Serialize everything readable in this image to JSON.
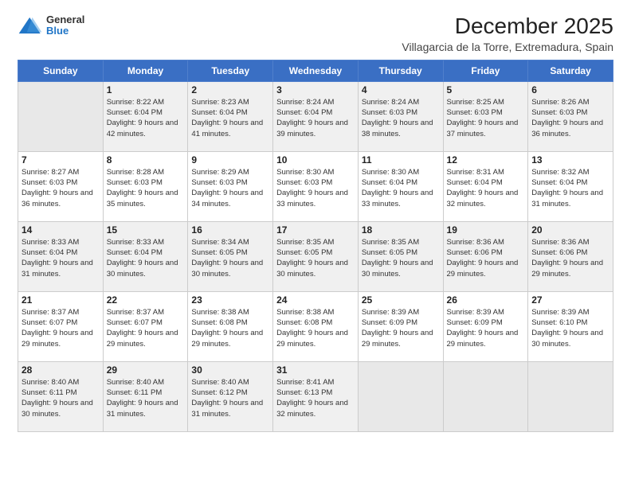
{
  "logo": {
    "general": "General",
    "blue": "Blue"
  },
  "header": {
    "title": "December 2025",
    "subtitle": "Villagarcia de la Torre, Extremadura, Spain"
  },
  "weekdays": [
    "Sunday",
    "Monday",
    "Tuesday",
    "Wednesday",
    "Thursday",
    "Friday",
    "Saturday"
  ],
  "weeks": [
    [
      {
        "day": "",
        "sunrise": "",
        "sunset": "",
        "daylight": "",
        "empty": true
      },
      {
        "day": "1",
        "sunrise": "Sunrise: 8:22 AM",
        "sunset": "Sunset: 6:04 PM",
        "daylight": "Daylight: 9 hours and 42 minutes."
      },
      {
        "day": "2",
        "sunrise": "Sunrise: 8:23 AM",
        "sunset": "Sunset: 6:04 PM",
        "daylight": "Daylight: 9 hours and 41 minutes."
      },
      {
        "day": "3",
        "sunrise": "Sunrise: 8:24 AM",
        "sunset": "Sunset: 6:04 PM",
        "daylight": "Daylight: 9 hours and 39 minutes."
      },
      {
        "day": "4",
        "sunrise": "Sunrise: 8:24 AM",
        "sunset": "Sunset: 6:03 PM",
        "daylight": "Daylight: 9 hours and 38 minutes."
      },
      {
        "day": "5",
        "sunrise": "Sunrise: 8:25 AM",
        "sunset": "Sunset: 6:03 PM",
        "daylight": "Daylight: 9 hours and 37 minutes."
      },
      {
        "day": "6",
        "sunrise": "Sunrise: 8:26 AM",
        "sunset": "Sunset: 6:03 PM",
        "daylight": "Daylight: 9 hours and 36 minutes."
      }
    ],
    [
      {
        "day": "7",
        "sunrise": "Sunrise: 8:27 AM",
        "sunset": "Sunset: 6:03 PM",
        "daylight": "Daylight: 9 hours and 36 minutes."
      },
      {
        "day": "8",
        "sunrise": "Sunrise: 8:28 AM",
        "sunset": "Sunset: 6:03 PM",
        "daylight": "Daylight: 9 hours and 35 minutes."
      },
      {
        "day": "9",
        "sunrise": "Sunrise: 8:29 AM",
        "sunset": "Sunset: 6:03 PM",
        "daylight": "Daylight: 9 hours and 34 minutes."
      },
      {
        "day": "10",
        "sunrise": "Sunrise: 8:30 AM",
        "sunset": "Sunset: 6:03 PM",
        "daylight": "Daylight: 9 hours and 33 minutes."
      },
      {
        "day": "11",
        "sunrise": "Sunrise: 8:30 AM",
        "sunset": "Sunset: 6:04 PM",
        "daylight": "Daylight: 9 hours and 33 minutes."
      },
      {
        "day": "12",
        "sunrise": "Sunrise: 8:31 AM",
        "sunset": "Sunset: 6:04 PM",
        "daylight": "Daylight: 9 hours and 32 minutes."
      },
      {
        "day": "13",
        "sunrise": "Sunrise: 8:32 AM",
        "sunset": "Sunset: 6:04 PM",
        "daylight": "Daylight: 9 hours and 31 minutes."
      }
    ],
    [
      {
        "day": "14",
        "sunrise": "Sunrise: 8:33 AM",
        "sunset": "Sunset: 6:04 PM",
        "daylight": "Daylight: 9 hours and 31 minutes."
      },
      {
        "day": "15",
        "sunrise": "Sunrise: 8:33 AM",
        "sunset": "Sunset: 6:04 PM",
        "daylight": "Daylight: 9 hours and 30 minutes."
      },
      {
        "day": "16",
        "sunrise": "Sunrise: 8:34 AM",
        "sunset": "Sunset: 6:05 PM",
        "daylight": "Daylight: 9 hours and 30 minutes."
      },
      {
        "day": "17",
        "sunrise": "Sunrise: 8:35 AM",
        "sunset": "Sunset: 6:05 PM",
        "daylight": "Daylight: 9 hours and 30 minutes."
      },
      {
        "day": "18",
        "sunrise": "Sunrise: 8:35 AM",
        "sunset": "Sunset: 6:05 PM",
        "daylight": "Daylight: 9 hours and 30 minutes."
      },
      {
        "day": "19",
        "sunrise": "Sunrise: 8:36 AM",
        "sunset": "Sunset: 6:06 PM",
        "daylight": "Daylight: 9 hours and 29 minutes."
      },
      {
        "day": "20",
        "sunrise": "Sunrise: 8:36 AM",
        "sunset": "Sunset: 6:06 PM",
        "daylight": "Daylight: 9 hours and 29 minutes."
      }
    ],
    [
      {
        "day": "21",
        "sunrise": "Sunrise: 8:37 AM",
        "sunset": "Sunset: 6:07 PM",
        "daylight": "Daylight: 9 hours and 29 minutes."
      },
      {
        "day": "22",
        "sunrise": "Sunrise: 8:37 AM",
        "sunset": "Sunset: 6:07 PM",
        "daylight": "Daylight: 9 hours and 29 minutes."
      },
      {
        "day": "23",
        "sunrise": "Sunrise: 8:38 AM",
        "sunset": "Sunset: 6:08 PM",
        "daylight": "Daylight: 9 hours and 29 minutes."
      },
      {
        "day": "24",
        "sunrise": "Sunrise: 8:38 AM",
        "sunset": "Sunset: 6:08 PM",
        "daylight": "Daylight: 9 hours and 29 minutes."
      },
      {
        "day": "25",
        "sunrise": "Sunrise: 8:39 AM",
        "sunset": "Sunset: 6:09 PM",
        "daylight": "Daylight: 9 hours and 29 minutes."
      },
      {
        "day": "26",
        "sunrise": "Sunrise: 8:39 AM",
        "sunset": "Sunset: 6:09 PM",
        "daylight": "Daylight: 9 hours and 29 minutes."
      },
      {
        "day": "27",
        "sunrise": "Sunrise: 8:39 AM",
        "sunset": "Sunset: 6:10 PM",
        "daylight": "Daylight: 9 hours and 30 minutes."
      }
    ],
    [
      {
        "day": "28",
        "sunrise": "Sunrise: 8:40 AM",
        "sunset": "Sunset: 6:11 PM",
        "daylight": "Daylight: 9 hours and 30 minutes."
      },
      {
        "day": "29",
        "sunrise": "Sunrise: 8:40 AM",
        "sunset": "Sunset: 6:11 PM",
        "daylight": "Daylight: 9 hours and 31 minutes."
      },
      {
        "day": "30",
        "sunrise": "Sunrise: 8:40 AM",
        "sunset": "Sunset: 6:12 PM",
        "daylight": "Daylight: 9 hours and 31 minutes."
      },
      {
        "day": "31",
        "sunrise": "Sunrise: 8:41 AM",
        "sunset": "Sunset: 6:13 PM",
        "daylight": "Daylight: 9 hours and 32 minutes."
      },
      {
        "day": "",
        "sunrise": "",
        "sunset": "",
        "daylight": "",
        "empty": true
      },
      {
        "day": "",
        "sunrise": "",
        "sunset": "",
        "daylight": "",
        "empty": true
      },
      {
        "day": "",
        "sunrise": "",
        "sunset": "",
        "daylight": "",
        "empty": true
      }
    ]
  ]
}
